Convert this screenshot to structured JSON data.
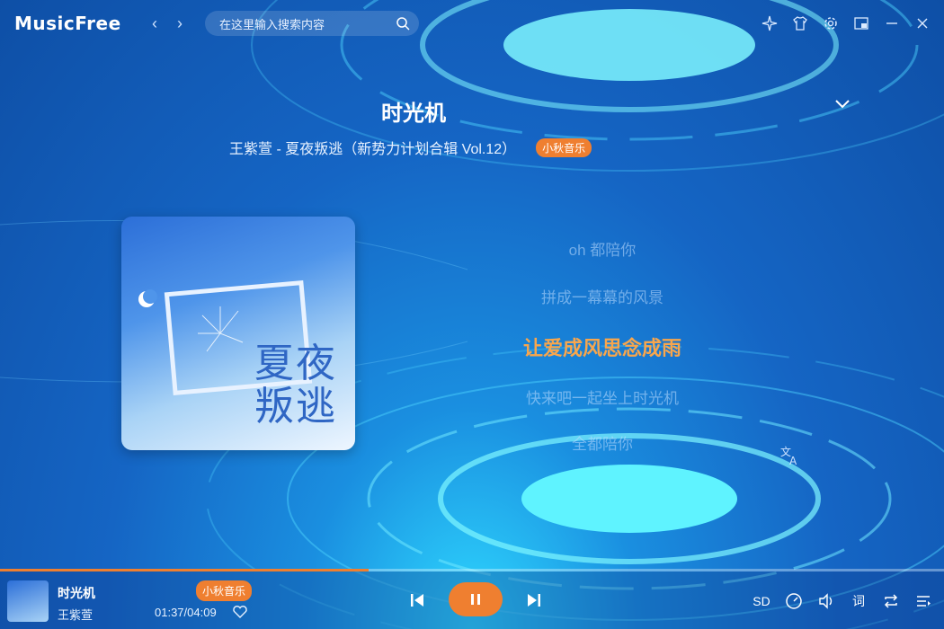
{
  "app": {
    "name": "MusicFree"
  },
  "search": {
    "placeholder": "在这里输入搜索内容"
  },
  "song": {
    "title": "时光机",
    "subtitle": "王紫萱 - 夏夜叛逃（新势力计划合辑 Vol.12）",
    "source_badge": "小秋音乐",
    "cover_text_line1": "夏夜",
    "cover_text_line2": "叛逃"
  },
  "lyrics": [
    {
      "text": "oh 都陪你",
      "active": false
    },
    {
      "text": "拼成一幕幕的风景",
      "active": false
    },
    {
      "text": "让爱成风思念成雨",
      "active": true
    },
    {
      "text": "快来吧一起坐上时光机",
      "active": false
    },
    {
      "text": "全都陪你",
      "active": false
    }
  ],
  "player": {
    "title": "时光机",
    "artist": "王紫萱",
    "source_badge": "小秋音乐",
    "time": "01:37/04:09",
    "progress": 0.39,
    "quality_label": "SD",
    "lyric_label": "词"
  },
  "colors": {
    "accent": "#ef7f30",
    "active_lyric": "#f7a64d"
  },
  "icons": {
    "top": [
      "back-icon",
      "forward-icon",
      "search-icon",
      "theme-sparkle-icon",
      "skin-shirt-icon",
      "settings-gear-icon",
      "minimode-icon",
      "minimize-icon",
      "close-icon"
    ],
    "bottom": [
      "prev-icon",
      "pause-icon",
      "next-icon",
      "speed-dial-icon",
      "volume-icon",
      "repeat-icon",
      "playlist-icon",
      "heart-icon",
      "translate-icon",
      "collapse-chevron-icon"
    ]
  }
}
